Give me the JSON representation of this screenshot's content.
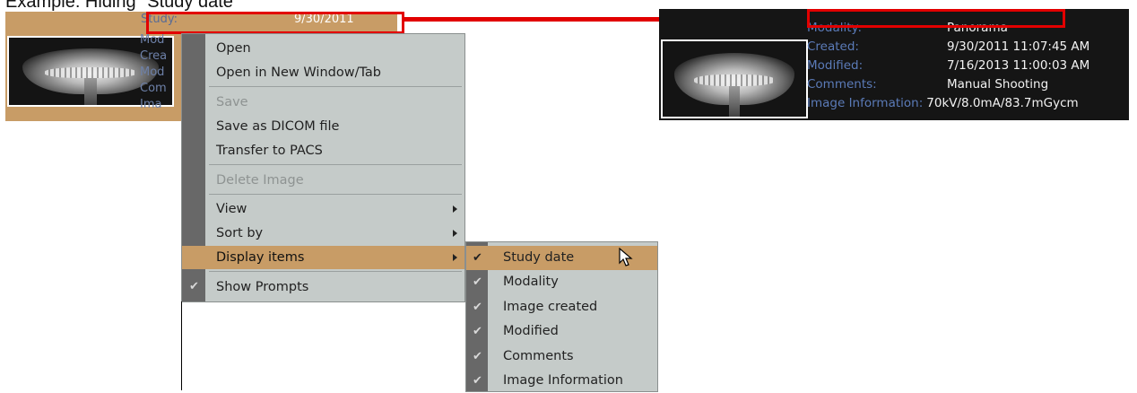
{
  "heading": "Example: Hiding \"Study date\"",
  "card": {
    "study_label": "Study:",
    "study_date": "9/30/2011",
    "rows": [
      "Mod",
      "Crea",
      "Mod",
      "Com",
      "Ima"
    ]
  },
  "details": {
    "rows": [
      {
        "label": "Modality:",
        "value": "Panorama"
      },
      {
        "label": "Created:",
        "value": "9/30/2011 11:07:45 AM"
      },
      {
        "label": "Modified:",
        "value": "7/16/2013 11:00:03 AM"
      },
      {
        "label": "Comments:",
        "value": "Manual Shooting"
      },
      {
        "label": "Image Information:",
        "value": "70kV/8.0mA/83.7mGycm"
      }
    ]
  },
  "menu": {
    "open": "Open",
    "open_new": "Open in New Window/Tab",
    "save": "Save",
    "save_dicom": "Save as DICOM file",
    "transfer": "Transfer to PACS",
    "delete": "Delete Image",
    "view": "View",
    "sort_by": "Sort by",
    "display_items": "Display items",
    "show_prompts": "Show Prompts",
    "check_glyph": "✔"
  },
  "submenu": {
    "items": [
      "Study date",
      "Modality",
      "Image created",
      "Modified",
      "Comments",
      "Image Information"
    ],
    "highlight_color": "#c89c66"
  },
  "colors": {
    "highlight": "#c89c66",
    "menu_bg": "#c5cbc9",
    "gutter": "#686868",
    "annotation_red": "#e20000",
    "dark_bg": "#151515",
    "label_blue": "#5b7bb8"
  }
}
